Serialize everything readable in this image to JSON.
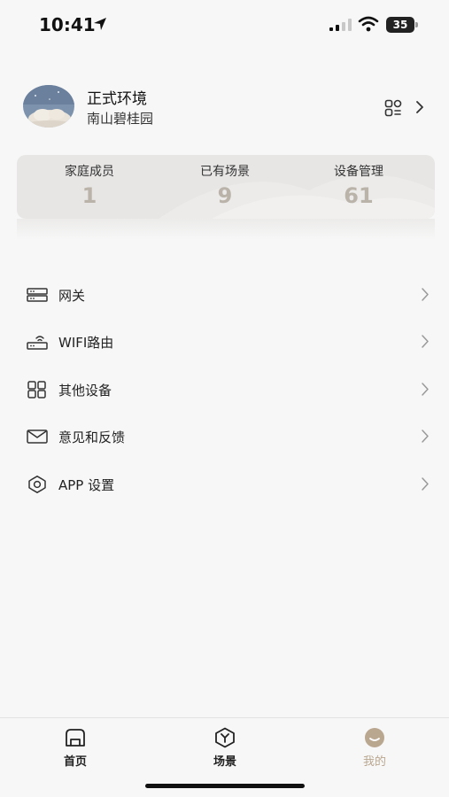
{
  "status_bar": {
    "time": "10:41",
    "battery_level": "35",
    "icons": [
      "location-arrow-icon",
      "signal-icon",
      "wifi-icon",
      "battery-icon"
    ]
  },
  "profile": {
    "home_name": "正式环境",
    "address": "南山碧桂园",
    "icons": [
      "avatar",
      "switch-home-icon",
      "chevron-right-icon"
    ]
  },
  "stats": [
    {
      "label": "家庭成员",
      "value": "1"
    },
    {
      "label": "已有场景",
      "value": "9"
    },
    {
      "label": "设备管理",
      "value": "61"
    }
  ],
  "menu": [
    {
      "label": "网关",
      "icon": "gateway-icon"
    },
    {
      "label": "WIFI路由",
      "icon": "router-icon"
    },
    {
      "label": "其他设备",
      "icon": "grid-icon"
    },
    {
      "label": "意见和反馈",
      "icon": "mail-icon"
    },
    {
      "label": "APP 设置",
      "icon": "gear-icon"
    }
  ],
  "tabs": [
    {
      "label": "首页",
      "icon": "home-icon",
      "active": false
    },
    {
      "label": "场景",
      "icon": "scene-icon",
      "active": false
    },
    {
      "label": "我的",
      "icon": "profile-face-icon",
      "active": true
    }
  ],
  "colors": {
    "accent": "#b9a790",
    "stat_value": "#b9b3aa",
    "background": "#f7f7f7"
  }
}
